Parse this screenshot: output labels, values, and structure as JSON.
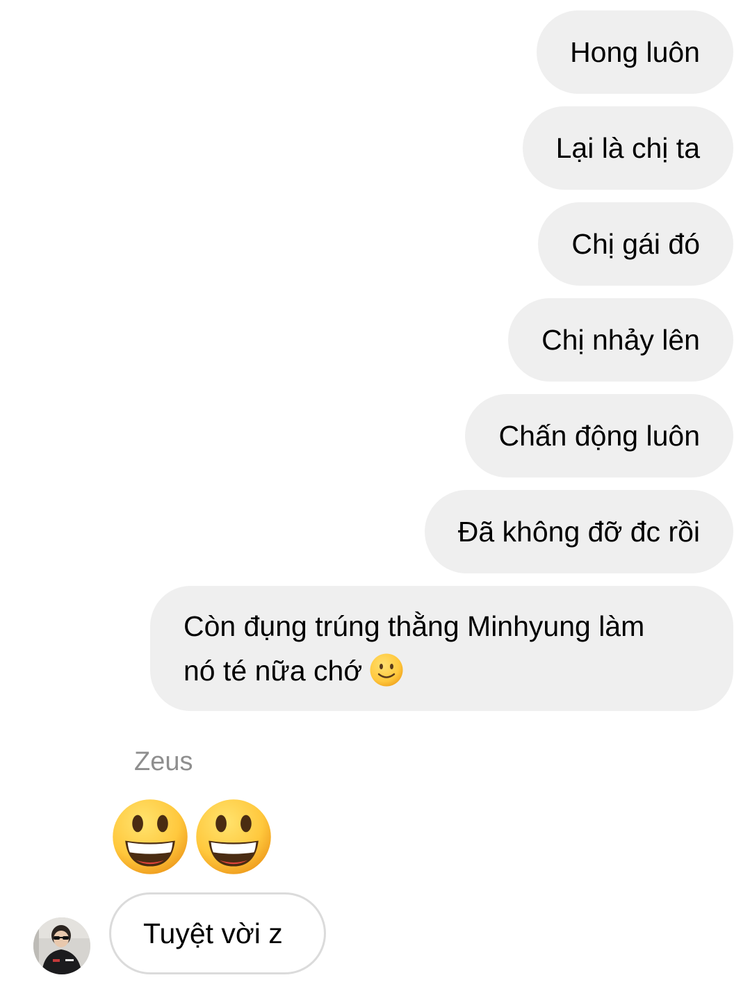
{
  "messages_outgoing": [
    {
      "text": "Hong luôn"
    },
    {
      "text": "Lại là chị ta"
    },
    {
      "text": "Chị gái đó"
    },
    {
      "text": "Chị nhảy lên"
    },
    {
      "text": "Chấn động luôn"
    },
    {
      "text": "Đã không đỡ đc rồi"
    },
    {
      "line1": "Còn đụng trúng thằng Minhyung làm",
      "line2": "nó té nữa chớ",
      "emoji": "slightly-smiling-face"
    }
  ],
  "incoming": {
    "sender_name": "Zeus",
    "emoji_message": [
      "grinning-face-big-eyes",
      "grinning-face-big-eyes"
    ],
    "text_message": "Tuyệt vời z",
    "avatar": "user-avatar"
  },
  "colors": {
    "outgoing_bubble": "#efefef",
    "incoming_border": "#dbdbdb",
    "sender_name": "#8e8e8e",
    "emoji_yellow": "#ffc83d"
  }
}
